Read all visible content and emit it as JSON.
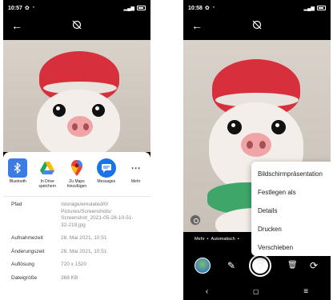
{
  "left_screen": {
    "status": {
      "time": "10:57"
    },
    "share_apps": [
      {
        "label": "Bluetooth",
        "icon": "bluetooth-icon",
        "color": "#3d7be4"
      },
      {
        "label": "In Drive\nspeichern",
        "icon": "google-drive-icon",
        "color": "#ffffff"
      },
      {
        "label": "Zu Maps\nhinzufügen",
        "icon": "google-maps-icon",
        "color": "#ffffff"
      },
      {
        "label": "Messages",
        "icon": "messages-icon",
        "color": "#1a73e8"
      },
      {
        "label": "Mehr",
        "icon": "more-horizontal-icon",
        "color": "#ffffff"
      }
    ],
    "details": [
      {
        "key": "Pfad",
        "value": "/storage/emulated/0/\nPictures/Screenshots/\nScreenshot_2021-05-28-10-51-\n32-219.jpg"
      },
      {
        "key": "Aufnahmezeit",
        "value": "28. Mai 2021, 10:51"
      },
      {
        "key": "Änderungszeit",
        "value": "28. Mai 2021, 10:51"
      },
      {
        "key": "Auflösung",
        "value": "720 x 1520"
      },
      {
        "key": "Dateigröße",
        "value": "368 KB"
      }
    ]
  },
  "right_screen": {
    "status": {
      "time": "10:58"
    },
    "caption": {
      "more": "Mehr",
      "sep": "•",
      "auto": "Automatisch",
      "sep2": "•"
    },
    "menu_items": [
      "Bildschirmpräsentation",
      "Festlegen als",
      "Details",
      "Drucken",
      "Verschieben"
    ]
  }
}
